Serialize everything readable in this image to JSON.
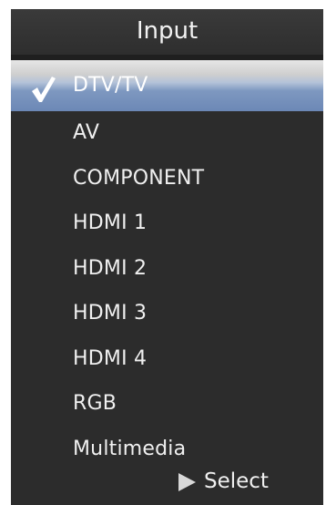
{
  "menu": {
    "title": "Input",
    "selected_index": 0,
    "items": [
      {
        "label": "DTV/TV",
        "checked": true
      },
      {
        "label": "AV",
        "checked": false
      },
      {
        "label": "COMPONENT",
        "checked": false
      },
      {
        "label": "HDMI 1",
        "checked": false
      },
      {
        "label": "HDMI 2",
        "checked": false
      },
      {
        "label": "HDMI 3",
        "checked": false
      },
      {
        "label": "HDMI 4",
        "checked": false
      },
      {
        "label": "RGB",
        "checked": false
      },
      {
        "label": "Multimedia",
        "checked": false
      }
    ],
    "footer": {
      "icon": "play-arrow-icon",
      "label": "Select"
    }
  },
  "colors": {
    "panel_background": "#2c2c2c",
    "highlight_top": "#e6e6e6",
    "highlight_bottom": "#6c88b6",
    "text": "#f0f0f0"
  }
}
